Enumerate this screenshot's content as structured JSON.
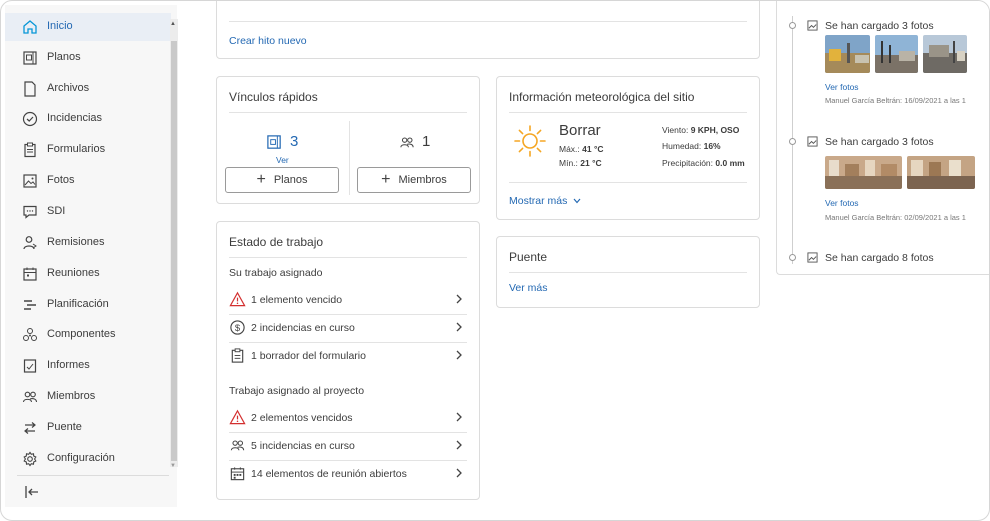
{
  "sidebar": {
    "items": [
      {
        "label": "Inicio",
        "icon": "home-icon"
      },
      {
        "label": "Planos",
        "icon": "sheets-icon"
      },
      {
        "label": "Archivos",
        "icon": "file-icon"
      },
      {
        "label": "Incidencias",
        "icon": "issue-check-icon"
      },
      {
        "label": "Formularios",
        "icon": "clipboard-icon"
      },
      {
        "label": "Fotos",
        "icon": "photo-icon"
      },
      {
        "label": "SDI",
        "icon": "chat-bubble-icon"
      },
      {
        "label": "Remisiones",
        "icon": "person-send-icon"
      },
      {
        "label": "Reuniones",
        "icon": "calendar-icon"
      },
      {
        "label": "Planificación",
        "icon": "schedule-icon"
      },
      {
        "label": "Componentes",
        "icon": "components-icon"
      },
      {
        "label": "Informes",
        "icon": "report-icon"
      },
      {
        "label": "Miembros",
        "icon": "members-icon"
      },
      {
        "label": "Puente",
        "icon": "bridge-arrows-icon"
      },
      {
        "label": "Configuración",
        "icon": "gear-icon"
      }
    ],
    "active_index": 0
  },
  "milestone": {
    "create_link": "Crear hito nuevo"
  },
  "quick_links": {
    "title": "Vínculos rápidos",
    "sheets_count": "3",
    "sheets_view": "Ver",
    "members_count": "1",
    "sheets_button": "Planos",
    "members_button": "Miembros"
  },
  "work_status": {
    "title": "Estado de trabajo",
    "assigned_heading": "Su trabajo asignado",
    "assigned_items": [
      {
        "label": "1 elemento vencido",
        "icon": "warning-triangle-icon"
      },
      {
        "label": "2 incidencias en curso",
        "icon": "dollar-circle-icon"
      },
      {
        "label": "1 borrador del formulario",
        "icon": "clipboard-icon"
      }
    ],
    "project_heading": "Trabajo asignado al proyecto",
    "project_items": [
      {
        "label": "2 elementos vencidos",
        "icon": "warning-triangle-icon"
      },
      {
        "label": "5 incidencias en curso",
        "icon": "members-icon"
      },
      {
        "label": "14 elementos de reunión abiertos",
        "icon": "calendar-grid-icon"
      }
    ]
  },
  "weather": {
    "title": "Información meteorológica del sitio",
    "condition": "Borrar",
    "max_label": "Máx.:",
    "max_value": "41 °C",
    "min_label": "Mín.:",
    "min_value": "21 °C",
    "wind_label": "Viento:",
    "wind_value": "9 KPH, OSO",
    "humidity_label": "Humedad:",
    "humidity_value": "16%",
    "precip_label": "Precipitación:",
    "precip_value": "0.0 mm",
    "show_more": "Mostrar más",
    "sun_color": "#f5a623"
  },
  "bridge": {
    "title": "Puente",
    "see_more": "Ver más"
  },
  "activity": {
    "items": [
      {
        "label": "Se han cargado 3 fotos",
        "view": "Ver fotos",
        "meta": "Manuel García Beltrán: 16/09/2021 a las 1"
      },
      {
        "label": "Se han cargado 3 fotos",
        "view": "Ver fotos",
        "meta": "Manuel García Beltrán: 02/09/2021 a las 1"
      },
      {
        "label": "Se han cargado 8 fotos"
      }
    ]
  },
  "colors": {
    "accent": "#2469b3",
    "active_bg": "#e9eef5",
    "warning": "#d32f2f"
  }
}
